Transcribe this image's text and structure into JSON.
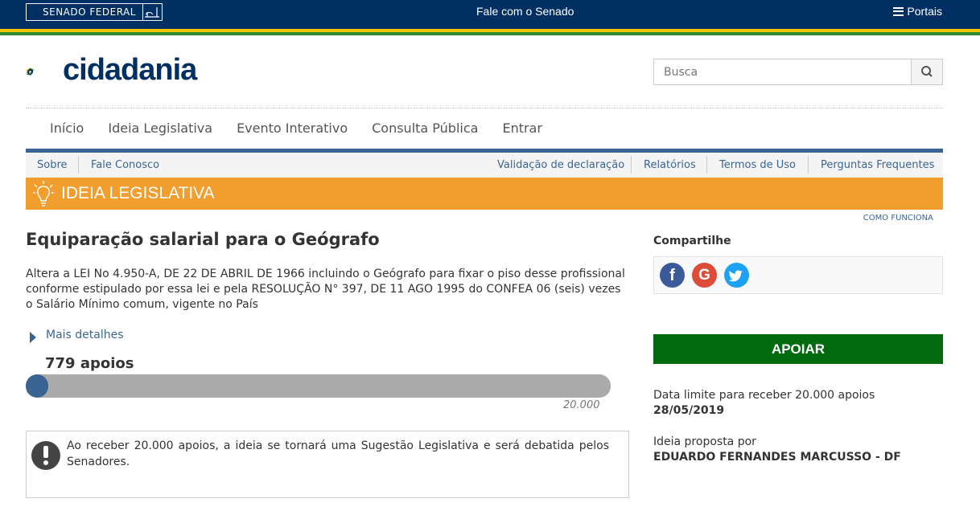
{
  "topbar": {
    "senado": "SENADO FEDERAL",
    "fale": "Fale com o Senado",
    "portais": "Portais"
  },
  "header": {
    "logo_text": "cidadania",
    "search_placeholder": "Busca"
  },
  "mainnav": [
    "Início",
    "Ideia Legislativa",
    "Evento Interativo",
    "Consulta Pública",
    "Entrar"
  ],
  "subnav": {
    "left": [
      "Sobre",
      "Fale Conosco"
    ],
    "right": [
      "Validação de declaração",
      "Relatórios",
      "Termos de Uso",
      "Perguntas Frequentes"
    ]
  },
  "banner": {
    "title": "IDEIA LEGISLATIVA",
    "como_funciona": "COMO FUNCIONA"
  },
  "idea": {
    "title": "Equiparação salarial para o Geógrafo",
    "description": "Altera a LEI No 4.950-A, DE 22 DE ABRIL DE 1966 incluindo o Geógrafo para fixar o piso desse profissional conforme estipulado por essa lei e pela RESOLUÇÃO N° 397, DE 11 AGO 1995 do CONFEA 06 (seis) vezes o Salário Mínimo comum, vigente no País",
    "mais_detalhes": "Mais detalhes",
    "apoios": "779 apoios",
    "progress_value": 779,
    "goal": "20.000",
    "goal_value": 20000,
    "notice": "Ao receber 20.000 apoios, a ideia se tornará uma Sugestão Legislativa e será debatida pelos Senadores."
  },
  "sidebar": {
    "compartilhe": "Compartilhe",
    "share_icons": [
      "facebook-icon",
      "google-icon",
      "twitter-icon"
    ],
    "apoiar": "APOIAR",
    "data_limite_label": "Data limite para receber 20.000 apoios",
    "data_limite": "28/05/2019",
    "proposta_label": "Ideia proposta por",
    "autor": "EDUARDO FERNANDES MARCUSSO - DF"
  },
  "colors": {
    "navy": "#003063",
    "orange": "#f19e2e",
    "green": "#006b0e",
    "blue": "#3a6592"
  }
}
